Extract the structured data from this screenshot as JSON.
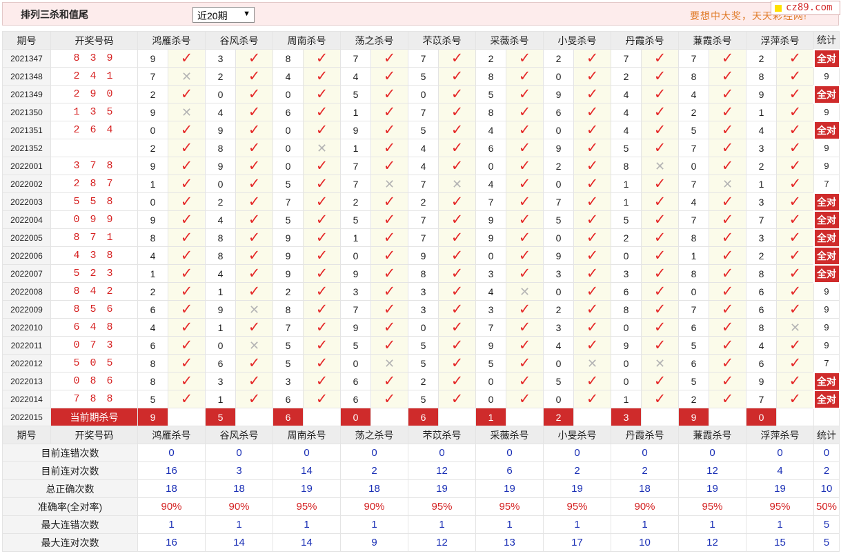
{
  "header": {
    "title": "排列三杀和值尾",
    "select_value": "近20期",
    "slogan": "要想中大奖，天天彩经网!",
    "logo_text": "cz89.com"
  },
  "columns": {
    "issue": "期号",
    "numbers": "开奖号码",
    "experts": [
      "鸿雁杀号",
      "谷风杀号",
      "周南杀号",
      "荡之杀号",
      "芣苡杀号",
      "采薇杀号",
      "小旻杀号",
      "丹霞杀号",
      "蒹霞杀号",
      "浮萍杀号"
    ],
    "stats": "统计"
  },
  "rows": [
    {
      "issue": "2021347",
      "numbers": "8 3 9",
      "kills": [
        9,
        3,
        8,
        7,
        7,
        2,
        2,
        7,
        7,
        2
      ],
      "hits": [
        1,
        1,
        1,
        1,
        1,
        1,
        1,
        1,
        1,
        1
      ],
      "stat": "全对"
    },
    {
      "issue": "2021348",
      "numbers": "2 4 1",
      "kills": [
        7,
        2,
        4,
        4,
        5,
        8,
        0,
        2,
        8,
        8
      ],
      "hits": [
        0,
        1,
        1,
        1,
        1,
        1,
        1,
        1,
        1,
        1
      ],
      "stat": "9"
    },
    {
      "issue": "2021349",
      "numbers": "2 9 0",
      "kills": [
        2,
        0,
        0,
        5,
        0,
        5,
        9,
        4,
        4,
        9
      ],
      "hits": [
        1,
        1,
        1,
        1,
        1,
        1,
        1,
        1,
        1,
        1
      ],
      "stat": "全对"
    },
    {
      "issue": "2021350",
      "numbers": "1 3 5",
      "kills": [
        9,
        4,
        6,
        1,
        7,
        8,
        6,
        4,
        2,
        1
      ],
      "hits": [
        0,
        1,
        1,
        1,
        1,
        1,
        1,
        1,
        1,
        1
      ],
      "stat": "9"
    },
    {
      "issue": "2021351",
      "numbers": "2 6 4",
      "kills": [
        0,
        9,
        0,
        9,
        5,
        4,
        0,
        4,
        5,
        4
      ],
      "hits": [
        1,
        1,
        1,
        1,
        1,
        1,
        1,
        1,
        1,
        1
      ],
      "stat": "全对"
    },
    {
      "issue": "2021352",
      "numbers": "",
      "kills": [
        2,
        8,
        0,
        1,
        4,
        6,
        9,
        5,
        7,
        3
      ],
      "hits": [
        1,
        1,
        0,
        1,
        1,
        1,
        1,
        1,
        1,
        1
      ],
      "stat": "9"
    },
    {
      "issue": "2022001",
      "numbers": "3 7 8",
      "kills": [
        9,
        9,
        0,
        7,
        4,
        0,
        2,
        8,
        0,
        2
      ],
      "hits": [
        1,
        1,
        1,
        1,
        1,
        1,
        1,
        0,
        1,
        1
      ],
      "stat": "9"
    },
    {
      "issue": "2022002",
      "numbers": "2 8 7",
      "kills": [
        1,
        0,
        5,
        7,
        7,
        4,
        0,
        1,
        7,
        1
      ],
      "hits": [
        1,
        1,
        1,
        0,
        0,
        1,
        1,
        1,
        0,
        1
      ],
      "stat": "7"
    },
    {
      "issue": "2022003",
      "numbers": "5 5 8",
      "kills": [
        0,
        2,
        7,
        2,
        2,
        7,
        7,
        1,
        4,
        3
      ],
      "hits": [
        1,
        1,
        1,
        1,
        1,
        1,
        1,
        1,
        1,
        1
      ],
      "stat": "全对"
    },
    {
      "issue": "2022004",
      "numbers": "0 9 9",
      "kills": [
        9,
        4,
        5,
        5,
        7,
        9,
        5,
        5,
        7,
        7
      ],
      "hits": [
        1,
        1,
        1,
        1,
        1,
        1,
        1,
        1,
        1,
        1
      ],
      "stat": "全对"
    },
    {
      "issue": "2022005",
      "numbers": "8 7 1",
      "kills": [
        8,
        8,
        9,
        1,
        7,
        9,
        0,
        2,
        8,
        3
      ],
      "hits": [
        1,
        1,
        1,
        1,
        1,
        1,
        1,
        1,
        1,
        1
      ],
      "stat": "全对"
    },
    {
      "issue": "2022006",
      "numbers": "4 3 8",
      "kills": [
        4,
        8,
        9,
        0,
        9,
        0,
        9,
        0,
        1,
        2
      ],
      "hits": [
        1,
        1,
        1,
        1,
        1,
        1,
        1,
        1,
        1,
        1
      ],
      "stat": "全对"
    },
    {
      "issue": "2022007",
      "numbers": "5 2 3",
      "kills": [
        1,
        4,
        9,
        9,
        8,
        3,
        3,
        3,
        8,
        8
      ],
      "hits": [
        1,
        1,
        1,
        1,
        1,
        1,
        1,
        1,
        1,
        1
      ],
      "stat": "全对"
    },
    {
      "issue": "2022008",
      "numbers": "8 4 2",
      "kills": [
        2,
        1,
        2,
        3,
        3,
        4,
        0,
        6,
        0,
        6
      ],
      "hits": [
        1,
        1,
        1,
        1,
        1,
        0,
        1,
        1,
        1,
        1
      ],
      "stat": "9"
    },
    {
      "issue": "2022009",
      "numbers": "8 5 6",
      "kills": [
        6,
        9,
        8,
        7,
        3,
        3,
        2,
        8,
        7,
        6
      ],
      "hits": [
        1,
        0,
        1,
        1,
        1,
        1,
        1,
        1,
        1,
        1
      ],
      "stat": "9"
    },
    {
      "issue": "2022010",
      "numbers": "6 4 8",
      "kills": [
        4,
        1,
        7,
        9,
        0,
        7,
        3,
        0,
        6,
        8
      ],
      "hits": [
        1,
        1,
        1,
        1,
        1,
        1,
        1,
        1,
        1,
        0
      ],
      "stat": "9"
    },
    {
      "issue": "2022011",
      "numbers": "0 7 3",
      "kills": [
        6,
        0,
        5,
        5,
        5,
        9,
        4,
        9,
        5,
        4
      ],
      "hits": [
        1,
        0,
        1,
        1,
        1,
        1,
        1,
        1,
        1,
        1
      ],
      "stat": "9"
    },
    {
      "issue": "2022012",
      "numbers": "5 0 5",
      "kills": [
        8,
        6,
        5,
        0,
        5,
        5,
        0,
        0,
        6,
        6
      ],
      "hits": [
        1,
        1,
        1,
        0,
        1,
        1,
        0,
        0,
        1,
        1
      ],
      "stat": "7"
    },
    {
      "issue": "2022013",
      "numbers": "0 8 6",
      "kills": [
        8,
        3,
        3,
        6,
        2,
        0,
        5,
        0,
        5,
        9
      ],
      "hits": [
        1,
        1,
        1,
        1,
        1,
        1,
        1,
        1,
        1,
        1
      ],
      "stat": "全对"
    },
    {
      "issue": "2022014",
      "numbers": "7 8 8",
      "kills": [
        5,
        1,
        6,
        6,
        5,
        0,
        0,
        1,
        2,
        7
      ],
      "hits": [
        1,
        1,
        1,
        1,
        1,
        1,
        1,
        1,
        1,
        1
      ],
      "stat": "全对"
    }
  ],
  "current": {
    "issue": "2022015",
    "label": "当前期杀号",
    "kills": [
      9,
      5,
      6,
      0,
      6,
      1,
      2,
      3,
      9,
      0
    ]
  },
  "summary": [
    {
      "label": "目前连错次数",
      "values": [
        "0",
        "0",
        "0",
        "0",
        "0",
        "0",
        "0",
        "0",
        "0",
        "0"
      ],
      "stat": "0"
    },
    {
      "label": "目前连对次数",
      "values": [
        "16",
        "3",
        "14",
        "2",
        "12",
        "6",
        "2",
        "2",
        "12",
        "4"
      ],
      "stat": "2"
    },
    {
      "label": "总正确次数",
      "values": [
        "18",
        "18",
        "19",
        "18",
        "19",
        "19",
        "19",
        "18",
        "19",
        "19"
      ],
      "stat": "10"
    },
    {
      "label": "准确率(全对率)",
      "values": [
        "90%",
        "90%",
        "95%",
        "90%",
        "95%",
        "95%",
        "95%",
        "90%",
        "95%",
        "95%"
      ],
      "stat": "50%",
      "rate": true
    },
    {
      "label": "最大连错次数",
      "values": [
        "1",
        "1",
        "1",
        "1",
        "1",
        "1",
        "1",
        "1",
        "1",
        "1"
      ],
      "stat": "5"
    },
    {
      "label": "最大连对次数",
      "values": [
        "16",
        "14",
        "14",
        "9",
        "12",
        "13",
        "17",
        "10",
        "12",
        "15"
      ],
      "stat": "5"
    }
  ]
}
